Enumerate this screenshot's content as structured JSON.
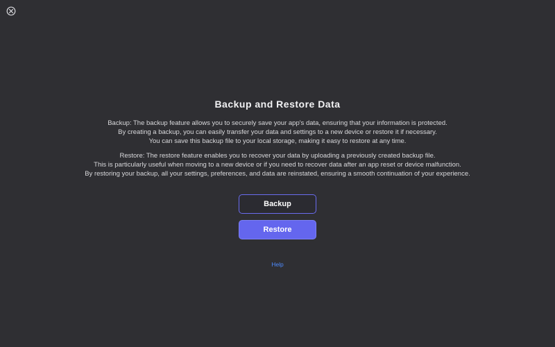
{
  "window": {
    "close_icon": "close-circle-x-icon"
  },
  "main": {
    "title": "Backup and Restore Data",
    "backup_description": [
      "Backup: The backup feature allows you to securely save your app's data, ensuring that your information is protected.",
      "By creating a backup, you can easily transfer your data and settings to a new device or restore it if necessary.",
      "You can save this backup file to your local storage, making it easy to restore at any time."
    ],
    "restore_description": [
      "Restore: The restore feature enables you to recover your data by uploading a previously created backup file.",
      "This is particularly useful when moving to a new device or if you need to recover data after an app reset or device malfunction.",
      "By restoring your backup, all your settings, preferences, and data are reinstated, ensuring a smooth continuation of your experience."
    ],
    "backup_button_label": "Backup",
    "restore_button_label": "Restore",
    "help_link_label": "Help"
  },
  "colors": {
    "background": "#2f2f33",
    "accent": "#6466ee",
    "link": "#4d8bff",
    "text": "#e6e6e8"
  }
}
